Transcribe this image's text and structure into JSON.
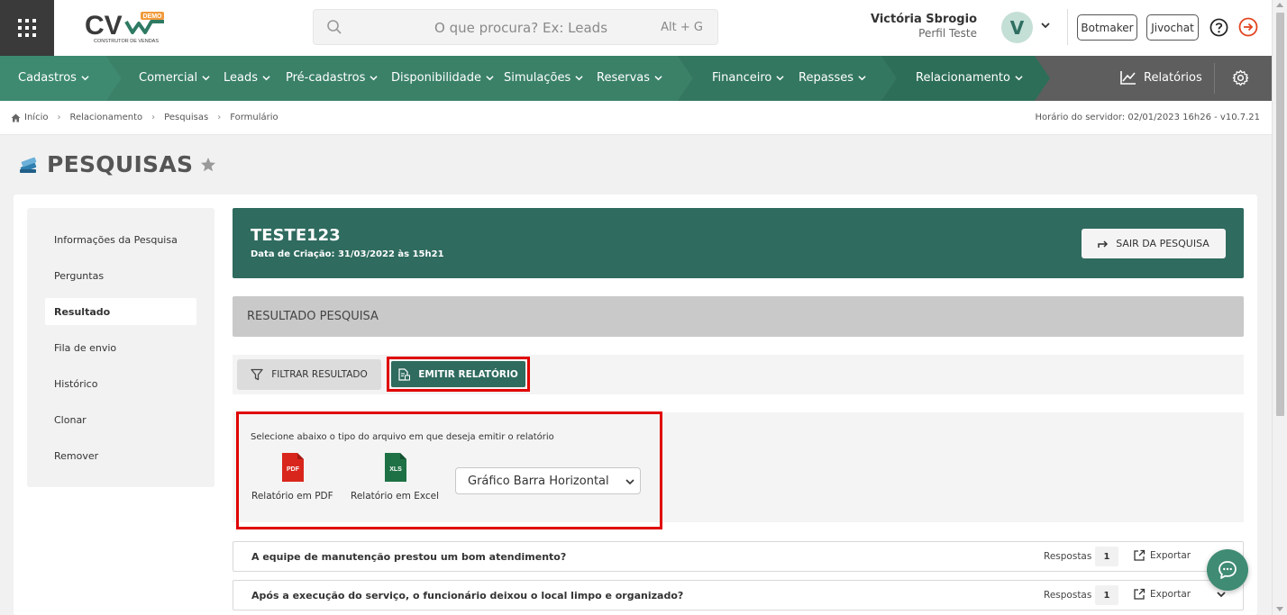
{
  "header": {
    "logo_text": "CV",
    "logo_badge": "DEMO",
    "logo_tagline": "CONSTRUTOR DE VENDAS",
    "search_placeholder": "O que procura? Ex: Leads",
    "search_shortcut": "Alt + G",
    "user_name": "Victória Sbrogio",
    "user_profile": "Perfil Teste",
    "avatar_initial": "V",
    "botmaker_label": "Botmaker",
    "jivochat_label": "Jivochat"
  },
  "nav": {
    "items": [
      {
        "label": "Cadastros"
      },
      {
        "label": "Comercial"
      },
      {
        "label": "Leads"
      },
      {
        "label": "Pré-cadastros"
      },
      {
        "label": "Disponibilidade"
      },
      {
        "label": "Simulações"
      },
      {
        "label": "Reservas"
      },
      {
        "label": "Financeiro"
      },
      {
        "label": "Repasses"
      },
      {
        "label": "Relacionamento"
      }
    ],
    "reports_label": "Relatórios",
    "colors": {
      "green_a": "#3d8a70",
      "green_b": "#2f7a62",
      "gray": "#5e5e5e"
    }
  },
  "breadcrumb": {
    "items": [
      "Início",
      "Relacionamento",
      "Pesquisas",
      "Formulário"
    ],
    "server_time": "Horário do servidor: 02/01/2023 16h26 - v10.7.21"
  },
  "page": {
    "title": "PESQUISAS"
  },
  "sidebar": {
    "items": [
      {
        "label": "Informações da Pesquisa"
      },
      {
        "label": "Perguntas"
      },
      {
        "label": "Resultado"
      },
      {
        "label": "Fila de envio"
      },
      {
        "label": "Histórico"
      },
      {
        "label": "Clonar"
      },
      {
        "label": "Remover"
      }
    ],
    "active": "Resultado"
  },
  "survey": {
    "name": "TESTE123",
    "created": "Data de Criação: 31/03/2022 às 15h21",
    "exit_label": "SAIR DA PESQUISA"
  },
  "result": {
    "section_title": "RESULTADO PESQUISA",
    "filter_label": "FILTRAR RESULTADO",
    "emit_label": "EMITIR RELATÓRIO"
  },
  "report": {
    "hint": "Selecione abaixo o tipo do arquivo em que deseja emitir o relatório",
    "pdf_badge": "PDF",
    "pdf_label": "Relatório em PDF",
    "xls_badge": "XLS",
    "xls_label": "Relatório em Excel",
    "chart_type": "Gráfico Barra Horizontal"
  },
  "questions": [
    {
      "text": "A equipe de manutenção prestou um bom atendimento?",
      "responses_label": "Respostas",
      "count": "1",
      "export_label": "Exportar"
    },
    {
      "text": "Após a execução do serviço, o funcionário deixou o local limpo e organizado?",
      "responses_label": "Respostas",
      "count": "1",
      "export_label": "Exportar"
    }
  ]
}
